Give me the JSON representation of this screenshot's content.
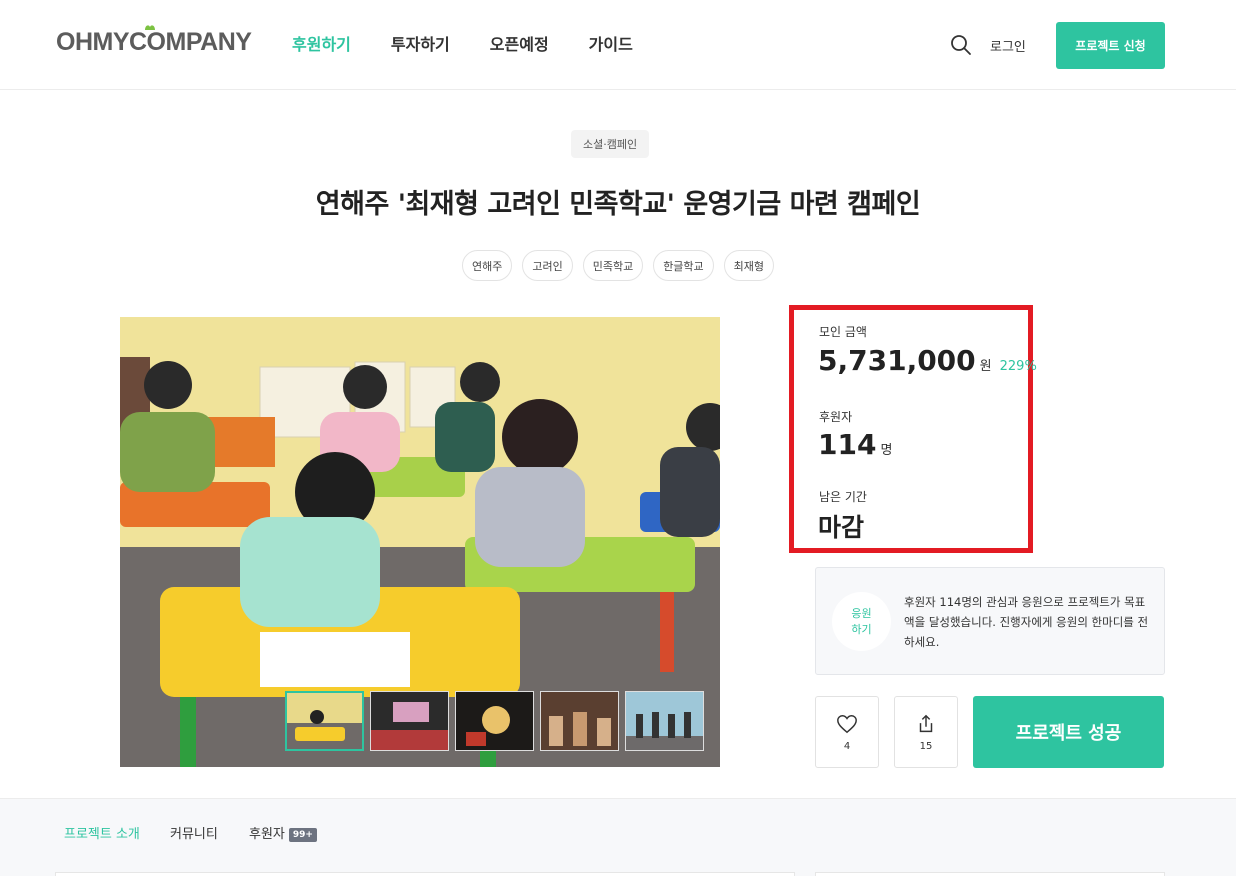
{
  "header": {
    "logo": "OHMYCOMPANY",
    "nav": [
      "후원하기",
      "투자하기",
      "오픈예정",
      "가이드"
    ],
    "login": "로그인",
    "apply_button": "프로젝트 신청"
  },
  "project": {
    "category": "소셜·캠페인",
    "title": "연해주 '최재형 고려인 민족학교' 운영기금 마련 캠페인",
    "tags": [
      "연해주",
      "고려인",
      "민족학교",
      "한글학교",
      "최재형"
    ]
  },
  "stats": {
    "amount_label": "모인 금액",
    "amount_value": "5,731,000",
    "amount_unit": "원",
    "amount_percent": "229%",
    "backers_label": "후원자",
    "backers_value": "114",
    "backers_unit": "명",
    "remaining_label": "남은 기간",
    "remaining_value": "마감"
  },
  "cheer": {
    "circle_line1": "응원",
    "circle_line2": "하기",
    "message": "후원자 114명의 관심과 응원으로 프로젝트가 목표액을 달성했습니다. 진행자에게 응원의 한마디를 전하세요."
  },
  "actions": {
    "like_count": "4",
    "share_count": "15",
    "status_button": "프로젝트 성공"
  },
  "tabs": {
    "intro": "프로젝트 소개",
    "community": "커뮤니티",
    "backers": "후원자",
    "backers_badge": "99+"
  },
  "colors": {
    "accent": "#2ec4a0",
    "highlight_border": "#e31b23"
  }
}
